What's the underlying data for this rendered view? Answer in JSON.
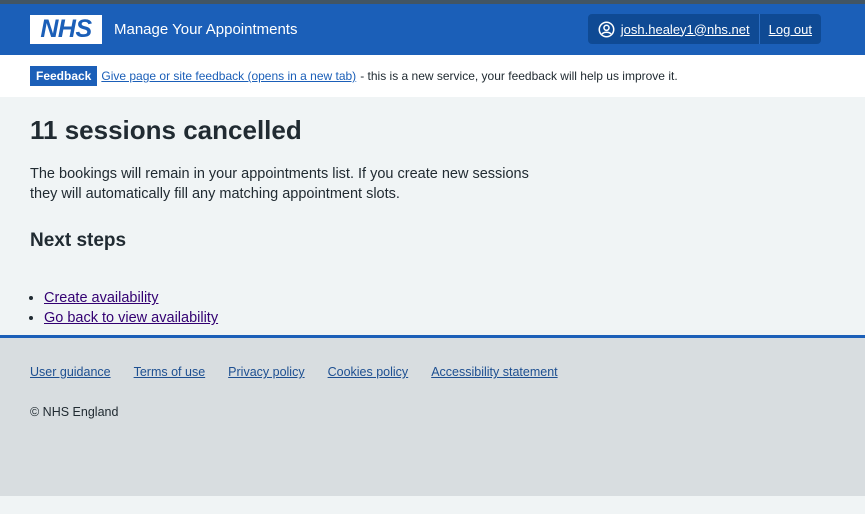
{
  "header": {
    "logo_text": "NHS",
    "service_name": "Manage Your Appointments",
    "user_email": "josh.healey1@nhs.net",
    "logout_label": "Log out"
  },
  "feedback": {
    "tag": "Feedback",
    "link_text": "Give page or site feedback (opens in a new tab)",
    "suffix": "- this is a new service, your feedback will help us improve it."
  },
  "main": {
    "title": "11 sessions cancelled",
    "lead_line1": "The bookings will remain in your appointments list. If you create new sessions",
    "lead_line2": "they will automatically fill any matching appointment slots.",
    "next_steps_heading": "Next steps",
    "next_steps": [
      {
        "label": "Create availability"
      },
      {
        "label": "Go back to view availability"
      }
    ]
  },
  "footer": {
    "links": [
      {
        "label": "User guidance"
      },
      {
        "label": "Terms of use"
      },
      {
        "label": "Privacy policy"
      },
      {
        "label": "Cookies policy"
      },
      {
        "label": "Accessibility statement"
      }
    ],
    "copyright": "© NHS England"
  },
  "colors": {
    "brand_blue": "#1b5fb8",
    "dark_blue": "#0f4a94",
    "page_bg": "#f0f4f5",
    "footer_bg": "#d8dde0",
    "visited_link": "#330072"
  }
}
